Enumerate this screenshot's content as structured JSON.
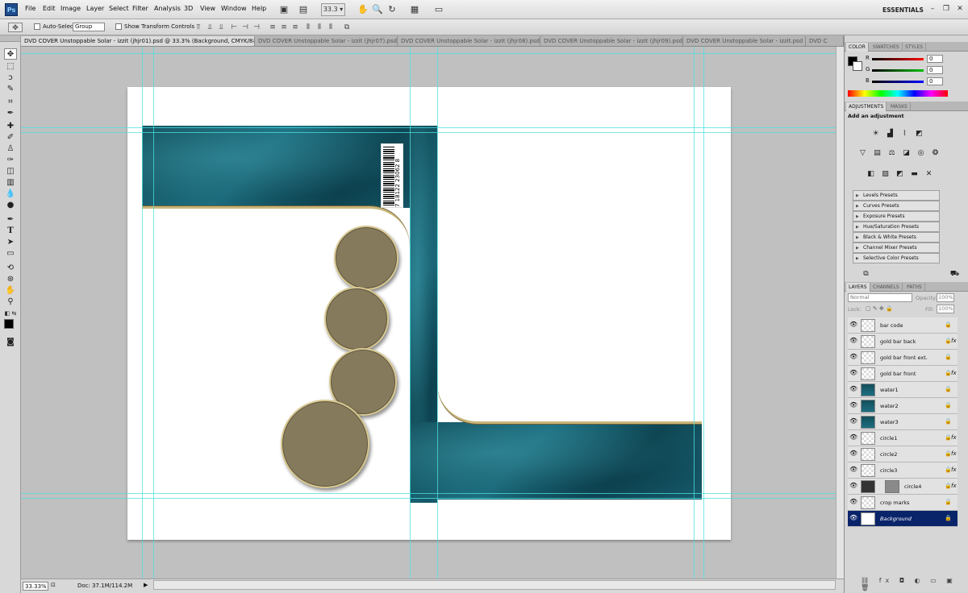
{
  "menubar": {
    "app_icon": "Ps",
    "items": [
      "File",
      "Edit",
      "Image",
      "Layer",
      "Select",
      "Filter",
      "Analysis",
      "3D",
      "View",
      "Window",
      "Help"
    ],
    "zoom_value": "33.3",
    "workspace": "ESSENTIALS"
  },
  "options": {
    "auto_select_label": "Auto-Select:",
    "auto_select_value": "Group",
    "show_transform_label": "Show Transform Controls"
  },
  "tabs": [
    {
      "label": "DVD COVER Unstoppable Solar - izzit (jhjr01).psd @ 33.3% (Background, CMYK/8#)",
      "close": "×"
    },
    {
      "label": "DVD COVER Unstoppable Solar - izzit (jhjr07).psd",
      "close": "×"
    },
    {
      "label": "DVD COVER Unstoppable Solar - izzit (jhjr08).psd",
      "close": "×"
    },
    {
      "label": "DVD COVER Unstoppable Solar - izzit (jhjr09).psd",
      "close": "×"
    },
    {
      "label": "DVD COVER Unstoppable Solar - izzit.psd",
      "close": "×"
    },
    {
      "label": "DVD C",
      "close": ""
    }
  ],
  "canvas": {
    "barcode_number": "7 18122 23062 8"
  },
  "status": {
    "zoom": "33.33%",
    "doc_size": "Doc: 37.1M/114.2M"
  },
  "color_panel": {
    "tabs": [
      "COLOR",
      "SWATCHES",
      "STYLES"
    ],
    "channels": [
      {
        "label": "R",
        "value": "0",
        "color": "#ff0000"
      },
      {
        "label": "G",
        "value": "0",
        "color": "#00c000"
      },
      {
        "label": "B",
        "value": "0",
        "color": "#0000ff"
      }
    ]
  },
  "adjustments_panel": {
    "tabs": [
      "ADJUSTMENTS",
      "MASKS"
    ],
    "heading": "Add an adjustment",
    "presets": [
      "Levels Presets",
      "Curves Presets",
      "Exposure Presets",
      "Hue/Saturation Presets",
      "Black & White Presets",
      "Channel Mixer Presets",
      "Selective Color Presets"
    ]
  },
  "layers_panel": {
    "tabs": [
      "LAYERS",
      "CHANNELS",
      "PATHS"
    ],
    "blend_mode": "Normal",
    "opacity_label": "Opacity:",
    "opacity_value": "100%",
    "lock_label": "Lock:",
    "fill_label": "Fill:",
    "fill_value": "100%",
    "layers": [
      {
        "name": "bar code",
        "thumb": "checker",
        "fx": false
      },
      {
        "name": "gold bar back",
        "thumb": "checker",
        "fx": true
      },
      {
        "name": "gold bar front ext.",
        "thumb": "checker",
        "fx": false
      },
      {
        "name": "gold bar front",
        "thumb": "checker",
        "fx": true
      },
      {
        "name": "water1",
        "thumb": "teal",
        "fx": false
      },
      {
        "name": "water2",
        "thumb": "teal",
        "fx": false
      },
      {
        "name": "water3",
        "thumb": "teal",
        "fx": false
      },
      {
        "name": "circle1",
        "thumb": "checker",
        "fx": true
      },
      {
        "name": "circle2",
        "thumb": "checker",
        "fx": true
      },
      {
        "name": "circle3",
        "thumb": "checker",
        "fx": true
      },
      {
        "name": "circle4",
        "thumb": "dark",
        "fx": true
      },
      {
        "name": "crop marks",
        "thumb": "checker",
        "fx": false
      },
      {
        "name": "Background",
        "thumb": "white",
        "fx": false
      }
    ]
  }
}
